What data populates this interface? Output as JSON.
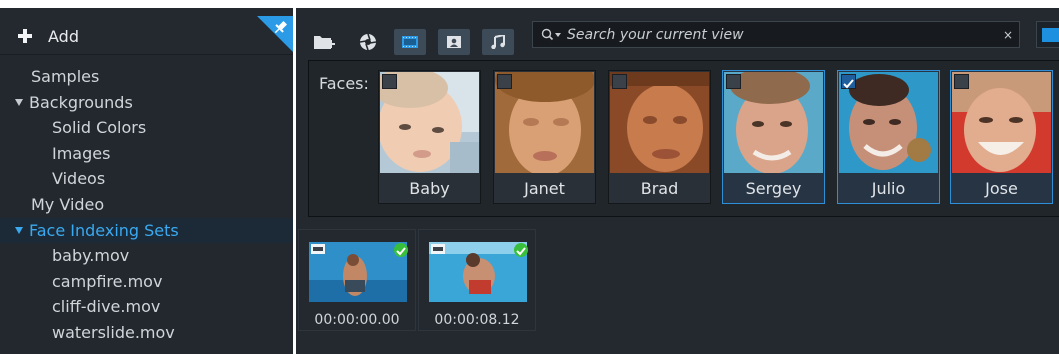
{
  "sidebar": {
    "add_label": "Add",
    "items": [
      {
        "label": "Samples"
      },
      {
        "label": "Backgrounds"
      },
      {
        "label": "Solid Colors"
      },
      {
        "label": "Images"
      },
      {
        "label": "Videos"
      },
      {
        "label": "My Video"
      },
      {
        "label": "Face Indexing Sets"
      },
      {
        "label": "baby.mov"
      },
      {
        "label": "campfire.mov"
      },
      {
        "label": "cliff-dive.mov"
      },
      {
        "label": "waterslide.mov"
      }
    ]
  },
  "toolbar": {
    "icons": [
      "folder-add-icon",
      "camera-aperture-icon",
      "video-filter-icon",
      "photo-filter-icon",
      "music-filter-icon"
    ],
    "search_placeholder": "Search your current view",
    "clear_glyph": "×"
  },
  "faces": {
    "label": "Faces:",
    "items": [
      {
        "name": "Baby",
        "checked": false,
        "selected": false
      },
      {
        "name": "Janet",
        "checked": false,
        "selected": false
      },
      {
        "name": "Brad",
        "checked": false,
        "selected": false
      },
      {
        "name": "Sergey",
        "checked": false,
        "selected": true
      },
      {
        "name": "Julio",
        "checked": true,
        "selected": true
      },
      {
        "name": "Jose",
        "checked": false,
        "selected": true
      }
    ]
  },
  "clips": [
    {
      "time": "00:00:00.00"
    },
    {
      "time": "00:00:08.12"
    }
  ],
  "colors": {
    "accent": "#2f8fd6",
    "selected_text": "#3aa9f0",
    "check_ok": "#38c03d"
  }
}
